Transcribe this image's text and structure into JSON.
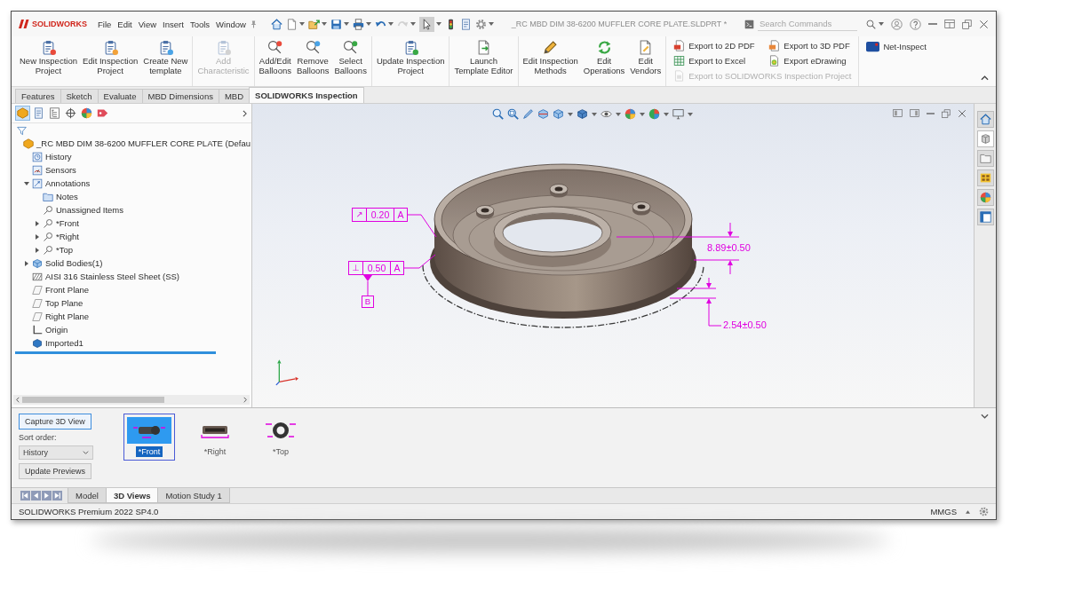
{
  "window": {
    "logo": "SOLIDWORKS",
    "title": "_RC MBD DIM 38-6200 MUFFLER CORE PLATE.SLDPRT *"
  },
  "menu": [
    "File",
    "Edit",
    "View",
    "Insert",
    "Tools",
    "Window"
  ],
  "quick_access": [
    {
      "pressed": false,
      "disabled": false
    },
    {
      "pressed": false,
      "disabled": false
    },
    {
      "pressed": false,
      "disabled": false
    },
    {
      "pressed": false,
      "disabled": false
    },
    {
      "pressed": false,
      "disabled": false
    },
    {
      "pressed": false,
      "disabled": false
    },
    {
      "pressed": false,
      "disabled": true
    },
    {
      "pressed": true,
      "disabled": false
    },
    {
      "pressed": false,
      "disabled": false
    },
    {
      "pressed": false,
      "disabled": false
    },
    {
      "pressed": false,
      "disabled": false
    }
  ],
  "search": {
    "placeholder": "Search Commands"
  },
  "ribbon": {
    "groups": [
      {
        "kind": "large",
        "buttons": [
          {
            "label": "New Inspection Project",
            "disabled": false
          },
          {
            "label": "Edit Inspection Project",
            "disabled": false
          },
          {
            "label": "Create New template",
            "disabled": false
          }
        ]
      },
      {
        "kind": "large",
        "buttons": [
          {
            "label": "Add Characteristic",
            "disabled": true
          }
        ]
      },
      {
        "kind": "large",
        "buttons": [
          {
            "label": "Add/Edit Balloons",
            "disabled": false
          },
          {
            "label": "Remove Balloons",
            "disabled": false
          },
          {
            "label": "Select Balloons",
            "disabled": false
          }
        ]
      },
      {
        "kind": "large",
        "buttons": [
          {
            "label": "Update Inspection Project",
            "disabled": false
          }
        ]
      },
      {
        "kind": "large",
        "buttons": [
          {
            "label": "Launch Template Editor",
            "disabled": false
          }
        ]
      },
      {
        "kind": "large",
        "buttons": [
          {
            "label": "Edit Inspection Methods",
            "disabled": false
          },
          {
            "label": "Edit Operations",
            "disabled": false
          },
          {
            "label": "Edit Vendors",
            "disabled": false
          }
        ]
      },
      {
        "kind": "small",
        "buttons": [
          {
            "label": "Export to 2D PDF",
            "disabled": false
          },
          {
            "label": "Export to 3D PDF",
            "disabled": false
          },
          {
            "label": "Export to Excel",
            "disabled": false
          },
          {
            "label": "Export eDrawing",
            "disabled": false
          },
          {
            "label": "Export to SOLIDWORKS Inspection Project",
            "disabled": true
          }
        ]
      },
      {
        "kind": "addin",
        "buttons": [
          {
            "label": "Net-Inspect",
            "disabled": false
          }
        ]
      }
    ]
  },
  "command_tabs": [
    {
      "label": "Features",
      "selected": false
    },
    {
      "label": "Sketch",
      "selected": false
    },
    {
      "label": "Evaluate",
      "selected": false
    },
    {
      "label": "MBD Dimensions",
      "selected": false
    },
    {
      "label": "MBD",
      "selected": false
    },
    {
      "label": "SOLIDWORKS Inspection",
      "selected": true
    }
  ],
  "panel_tabs": [
    {
      "selected": true
    },
    {
      "selected": false
    },
    {
      "selected": false
    },
    {
      "selected": false
    },
    {
      "selected": false
    },
    {
      "selected": false
    }
  ],
  "feature_tree": [
    {
      "kind": "part",
      "label": "_RC MBD DIM 38-6200 MUFFLER CORE PLATE (Defau",
      "children": [
        {
          "kind": "history",
          "label": "History"
        },
        {
          "kind": "sensors",
          "label": "Sensors"
        },
        {
          "kind": "annotations",
          "label": "Annotations",
          "expanded": true,
          "children": [
            {
              "kind": "notes",
              "label": "Notes"
            },
            {
              "kind": "unassigned",
              "label": "Unassigned Items"
            },
            {
              "kind": "view",
              "label": "*Front",
              "expanded": false
            },
            {
              "kind": "view",
              "label": "*Right",
              "expanded": false
            },
            {
              "kind": "view",
              "label": "*Top",
              "expanded": false
            }
          ]
        },
        {
          "kind": "bodies",
          "label": "Solid Bodies(1)",
          "expanded": false
        },
        {
          "kind": "material",
          "label": "AISI 316 Stainless Steel Sheet (SS)"
        },
        {
          "kind": "plane",
          "label": "Front Plane"
        },
        {
          "kind": "plane",
          "label": "Top Plane"
        },
        {
          "kind": "plane",
          "label": "Right Plane"
        },
        {
          "kind": "origin",
          "label": "Origin"
        },
        {
          "kind": "feature",
          "label": "Imported1"
        }
      ]
    }
  ],
  "graphics": {
    "annotations": [
      {
        "kind": "frame",
        "symbol": "↗",
        "tolerance": "0.20",
        "datum": "A"
      },
      {
        "kind": "frame",
        "symbol": "⊥",
        "tolerance": "0.50",
        "datum": "A"
      },
      {
        "kind": "datum",
        "label": "B"
      },
      {
        "kind": "dimension",
        "text": "8.89±0.50"
      },
      {
        "kind": "dimension",
        "text": "2.54±0.50"
      }
    ]
  },
  "task_pane": [
    {
      "selected": false
    },
    {
      "selected": true
    },
    {
      "selected": false
    },
    {
      "selected": false
    },
    {
      "selected": false
    },
    {
      "selected": false
    }
  ],
  "views_panel": {
    "capture_button": "Capture 3D View",
    "sort_label": "Sort order:",
    "sort_value": "History",
    "update_button": "Update Previews",
    "views": [
      {
        "label": "*Front",
        "selected": true
      },
      {
        "label": "*Right",
        "selected": false
      },
      {
        "label": "*Top",
        "selected": false
      }
    ]
  },
  "bottom_tabs": [
    {
      "label": "Model",
      "selected": false
    },
    {
      "label": "3D Views",
      "selected": true
    },
    {
      "label": "Motion Study 1",
      "selected": false
    }
  ],
  "status_bar": {
    "product": "SOLIDWORKS Premium 2022 SP4.0",
    "units": "MMGS"
  }
}
